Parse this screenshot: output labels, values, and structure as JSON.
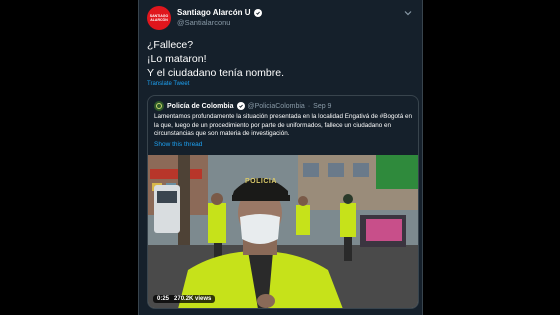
{
  "author": {
    "name": "Santiago Alarcón U",
    "handle": "@Santialarconu",
    "avatar_text": "SANTIAGO ALARCÓN"
  },
  "tweet": {
    "lines": [
      "¿Fallece?",
      "¡Lo mataron!",
      "Y el ciudadano tenía nombre."
    ],
    "translate_label": "Translate Tweet"
  },
  "quoted": {
    "name": "Policía de Colombia",
    "handle": "@PoliciaColombia",
    "separator": "·",
    "date": "Sep 9",
    "text": "Lamentamos profundamente la situación presentada en la localidad Engativá de #Bogotá en la que, luego de un procedimiento por parte de uniformados, fallece un ciudadano en circunstancias que son materia de investigación.",
    "thread_link": "Show this thread",
    "video": {
      "duration": "0:25",
      "views": "270.2K views",
      "cap_text": "POLICIA"
    }
  },
  "colors": {
    "background": "#15202b",
    "accent": "#1da1f2",
    "muted": "#8899a6",
    "vest": "#c6e21a"
  }
}
